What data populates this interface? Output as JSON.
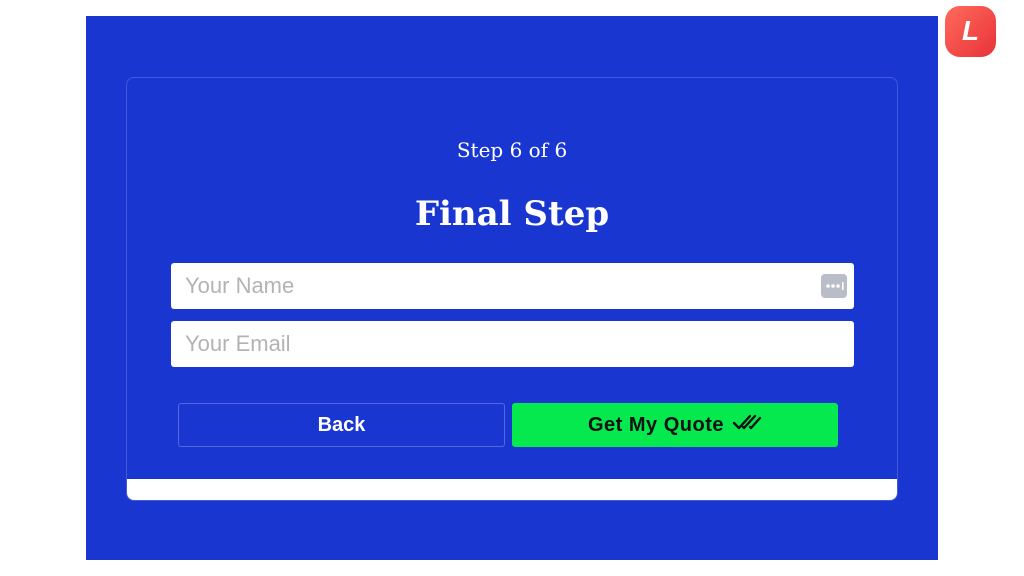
{
  "form": {
    "step_label": "Step 6 of 6",
    "title": "Final Step",
    "name_placeholder": "Your Name",
    "email_placeholder": "Your Email",
    "back_label": "Back",
    "submit_label": "Get My Quote",
    "submit_icon": "double-check-icon",
    "password_manager_icon": "password-manager-icon"
  },
  "logo": {
    "letter": "L",
    "icon": "app-logo-icon"
  },
  "colors": {
    "background": "#1a36d0",
    "submit": "#05e84e",
    "logo": "#f04545"
  }
}
